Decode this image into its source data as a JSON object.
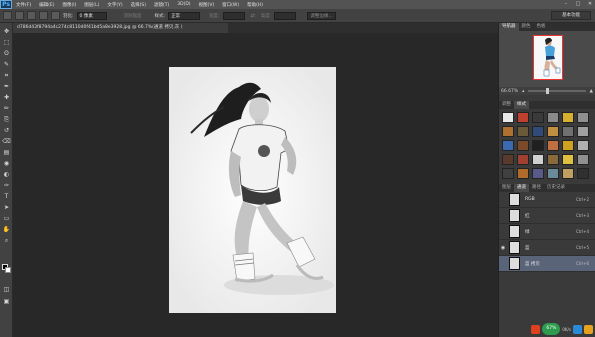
{
  "app": {
    "logo": "Ps"
  },
  "menu": [
    "文件(F)",
    "编辑(E)",
    "图像(I)",
    "图层(L)",
    "文字(Y)",
    "选择(S)",
    "滤镜(T)",
    "3D(D)",
    "视图(V)",
    "窗口(W)",
    "帮助(H)"
  ],
  "window_controls": [
    "–",
    "□",
    "✕"
  ],
  "options": {
    "feather_label": "羽化:",
    "feather_value": "0 像素",
    "antialias": "消除锯齿",
    "style_label": "样式:",
    "style_value": "正常",
    "width_label": "宽度:",
    "height_label": "高度:",
    "refine_edge": "调整边缘...",
    "workspace": "基本功能"
  },
  "document": {
    "tab_title": "d786d43f8794a4c274c8110d0f41bd5a8e3928.jpg @ 66.7%(通道 拷贝,灰 )"
  },
  "toolbar_icons": [
    "move-icon",
    "marquee-icon",
    "lasso-icon",
    "quick-select-icon",
    "crop-icon",
    "eyedropper-icon",
    "heal-icon",
    "brush-icon",
    "stamp-icon",
    "history-brush-icon",
    "eraser-icon",
    "gradient-icon",
    "blur-icon",
    "dodge-icon",
    "pen-icon",
    "type-icon",
    "path-select-icon",
    "shape-icon",
    "hand-icon",
    "zoom-icon"
  ],
  "toolbar_glyphs": [
    "✥",
    "⬚",
    "ʘ",
    "✎",
    "⌗",
    "✒",
    "✚",
    "✏",
    "⎘",
    "↺",
    "⌫",
    "▤",
    "◉",
    "◐",
    "✑",
    "T",
    "➤",
    "▭",
    "✋",
    "⌕"
  ],
  "panels": {
    "top_tabs": [
      "导航器",
      "颜色",
      "色板"
    ],
    "zoom": "66.67%",
    "style_tabs": [
      "调整",
      "样式"
    ],
    "style_colors": [
      "#e8e8e8",
      "#c04030",
      "#3a3a3a",
      "#8a8a8a",
      "#d8b030",
      "#909090",
      "#b07030",
      "#6a5a3a",
      "#304a7a",
      "#c09040",
      "#707070",
      "#a0a0a0",
      "#3a6ab0",
      "#7a4a2a",
      "#202020",
      "#c07040",
      "#d0a020",
      "#b0b0b0",
      "#5a3a2a",
      "#a04030",
      "#d0d0d0",
      "#8a6a3a",
      "#e0c040",
      "#909090",
      "#404040",
      "#b06a2a",
      "#5a5a8a",
      "#6a8a9a",
      "#c0a060",
      "#303030"
    ],
    "channel_tabs": [
      "图层",
      "通道",
      "路径",
      "历史记录"
    ],
    "channels": [
      {
        "name": "RGB",
        "shortcut": "Ctrl+2",
        "visible": false,
        "selected": false
      },
      {
        "name": "红",
        "shortcut": "Ctrl+3",
        "visible": false,
        "selected": false
      },
      {
        "name": "绿",
        "shortcut": "Ctrl+4",
        "visible": false,
        "selected": false
      },
      {
        "name": "蓝",
        "shortcut": "Ctrl+5",
        "visible": true,
        "selected": false
      },
      {
        "name": "蓝 拷贝",
        "shortcut": "Ctrl+6",
        "visible": false,
        "selected": true
      }
    ]
  },
  "tray": {
    "badge": "67%",
    "speed": "0K/s",
    "colors": [
      "#e04020",
      "#2a8ad8",
      "#e8a020"
    ]
  }
}
